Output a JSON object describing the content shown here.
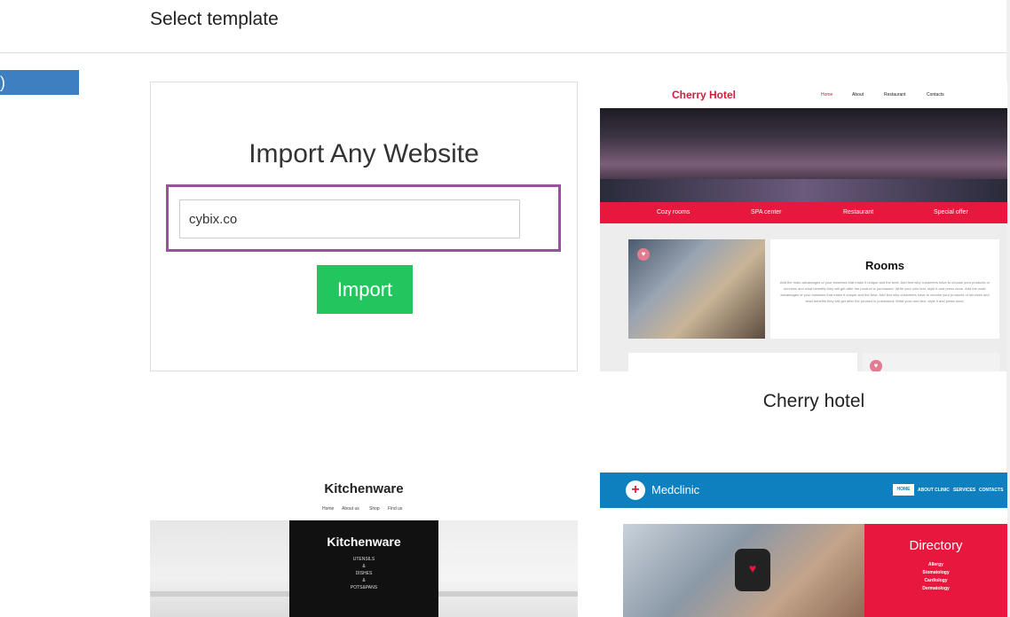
{
  "header": {
    "title": "Select template"
  },
  "side_tab": {
    "label": ")"
  },
  "import": {
    "title": "Import Any Website",
    "input_value": "cybix.co",
    "button_label": "Import"
  },
  "templates": {
    "cherry": {
      "label": "Cherry hotel",
      "logo": "Cherry Hotel",
      "menu": [
        "Home",
        "About",
        "Restaurant",
        "Contacts"
      ],
      "bar_items": [
        "Cozy rooms",
        "SPA center",
        "Restaurant",
        "Special offer"
      ],
      "room_title": "Rooms",
      "room_text": "Add the main advantages of your business that make it unique and the best. Add text why customers have to choose your products or services and what benefits they will get after the product is purchased. Write your own text, style it and press done. Add the main advantages of your business that make it unique and the best. Add text why customers have to choose your products or services and what benefits they will get after the product is purchased. Write your own text, style it and press done."
    },
    "kitchen": {
      "title": "Kitchenware",
      "menu": [
        "Home",
        "About us",
        "Shop",
        "Find us"
      ],
      "center_title": "Kitchenware",
      "center_list": [
        "UTENSILS",
        "&",
        "DISHES",
        "&",
        "POTS&PANS"
      ]
    },
    "med": {
      "logo": "Medclinic",
      "nav_active": "HOME",
      "nav_items": [
        "ABOUT CLINIC",
        "SERVICES",
        "CONTACTS"
      ],
      "directory_title": "Directory",
      "directory_list": [
        "Allergy",
        "Stomatology",
        "Cardiology",
        "Dermatology"
      ]
    }
  },
  "colors": {
    "accent_purple": "#9b4f9e",
    "import_green": "#22c55e",
    "side_tab_blue": "#3d7fc1",
    "cherry_red": "#e8173e",
    "med_blue": "#0e7fbf"
  }
}
